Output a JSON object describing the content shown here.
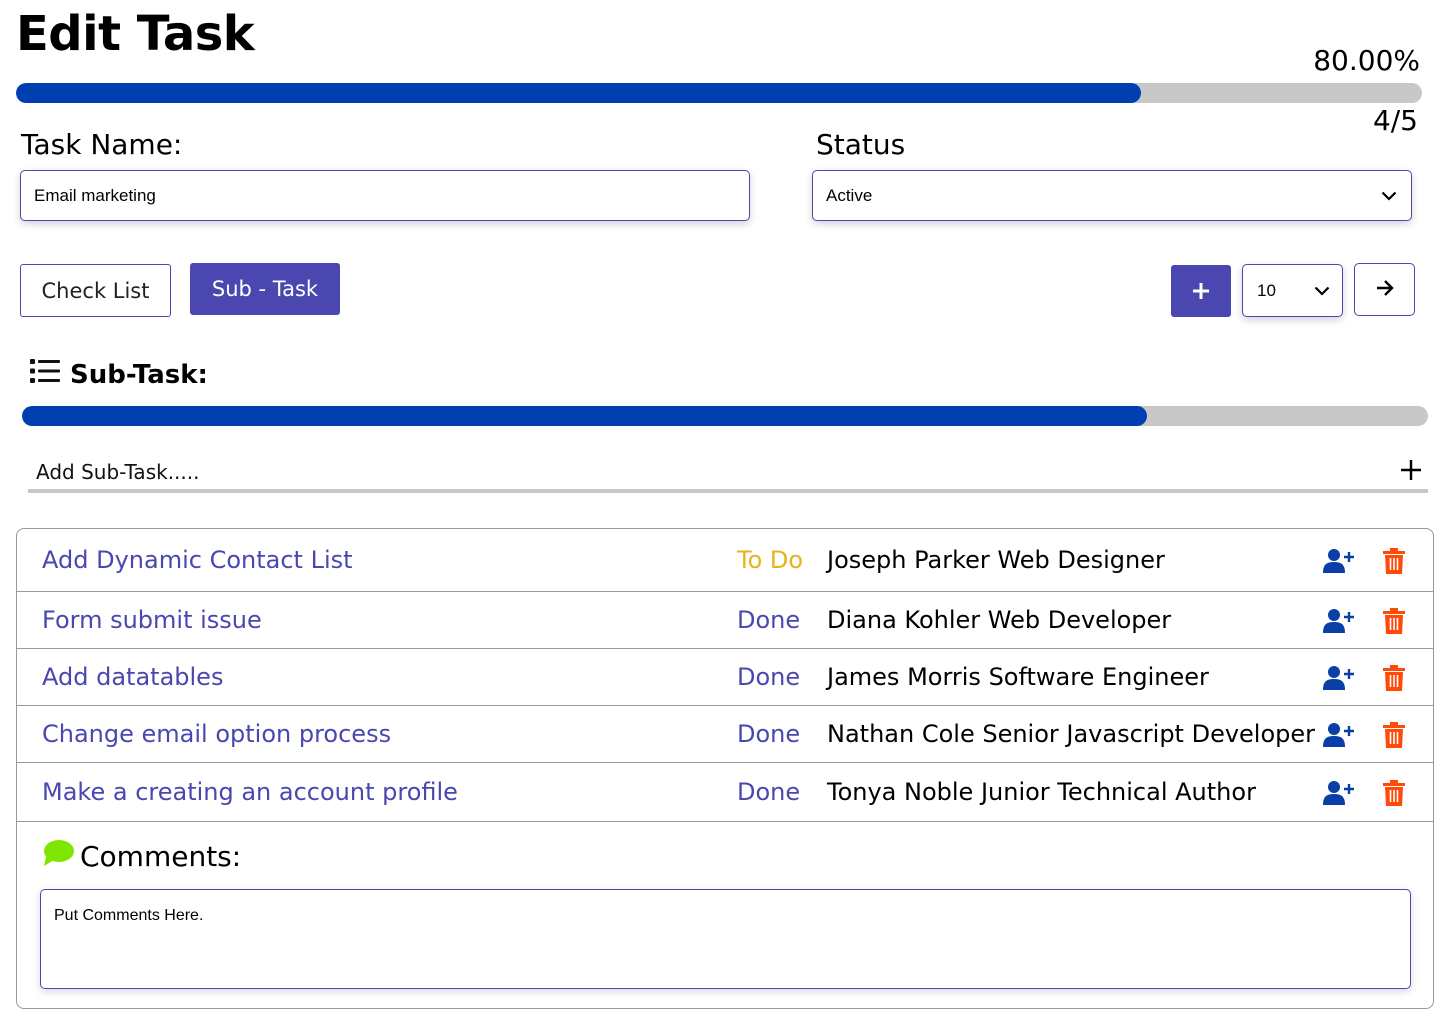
{
  "header": {
    "title": "Edit Task",
    "progress_percent_label": "80.00%",
    "progress_fraction": 0.8,
    "progress_count_label": "4/5"
  },
  "form": {
    "task_name_label": "Task Name:",
    "task_name_value": "Email marketing",
    "status_label": "Status",
    "status_value": "Active"
  },
  "toolbar": {
    "checklist_label": "Check List",
    "subtask_label": "Sub - Task",
    "add_label": "+",
    "page_size_value": "10",
    "next_icon": "arrow-right-icon"
  },
  "subtasks": {
    "heading": "Sub-Task:",
    "heading_icon": "list-icon",
    "progress_fraction": 0.8,
    "add_placeholder": "Add Sub-Task.....",
    "add_icon": "plus-icon",
    "items": [
      {
        "title": "Add Dynamic Contact List",
        "status": "To Do",
        "status_color": "#e6b31e",
        "assignee": "Joseph Parker Web Designer"
      },
      {
        "title": "Form submit issue",
        "status": "Done",
        "status_color": "#4a47b0",
        "assignee": "Diana Kohler Web Developer"
      },
      {
        "title": "Add datatables",
        "status": "Done",
        "status_color": "#4a47b0",
        "assignee": "James Morris Software Engineer"
      },
      {
        "title": "Change email option process",
        "status": "Done",
        "status_color": "#4a47b0",
        "assignee": "Nathan Cole Senior Javascript Developer"
      },
      {
        "title": "Make a creating an account profile",
        "status": "Done",
        "status_color": "#4a47b0",
        "assignee": "Tonya Noble Junior Technical Author"
      }
    ]
  },
  "comments": {
    "heading": "Comments:",
    "heading_icon": "comment-icon",
    "placeholder": "Put Comments Here."
  },
  "colors": {
    "accent": "#4a47b0",
    "progress": "#003fb0",
    "track": "#c8c8c8",
    "todo": "#e6b31e",
    "user_icon": "#0a3fa8",
    "trash_icon": "#ff4a0a",
    "comment_icon": "#7ee600"
  }
}
